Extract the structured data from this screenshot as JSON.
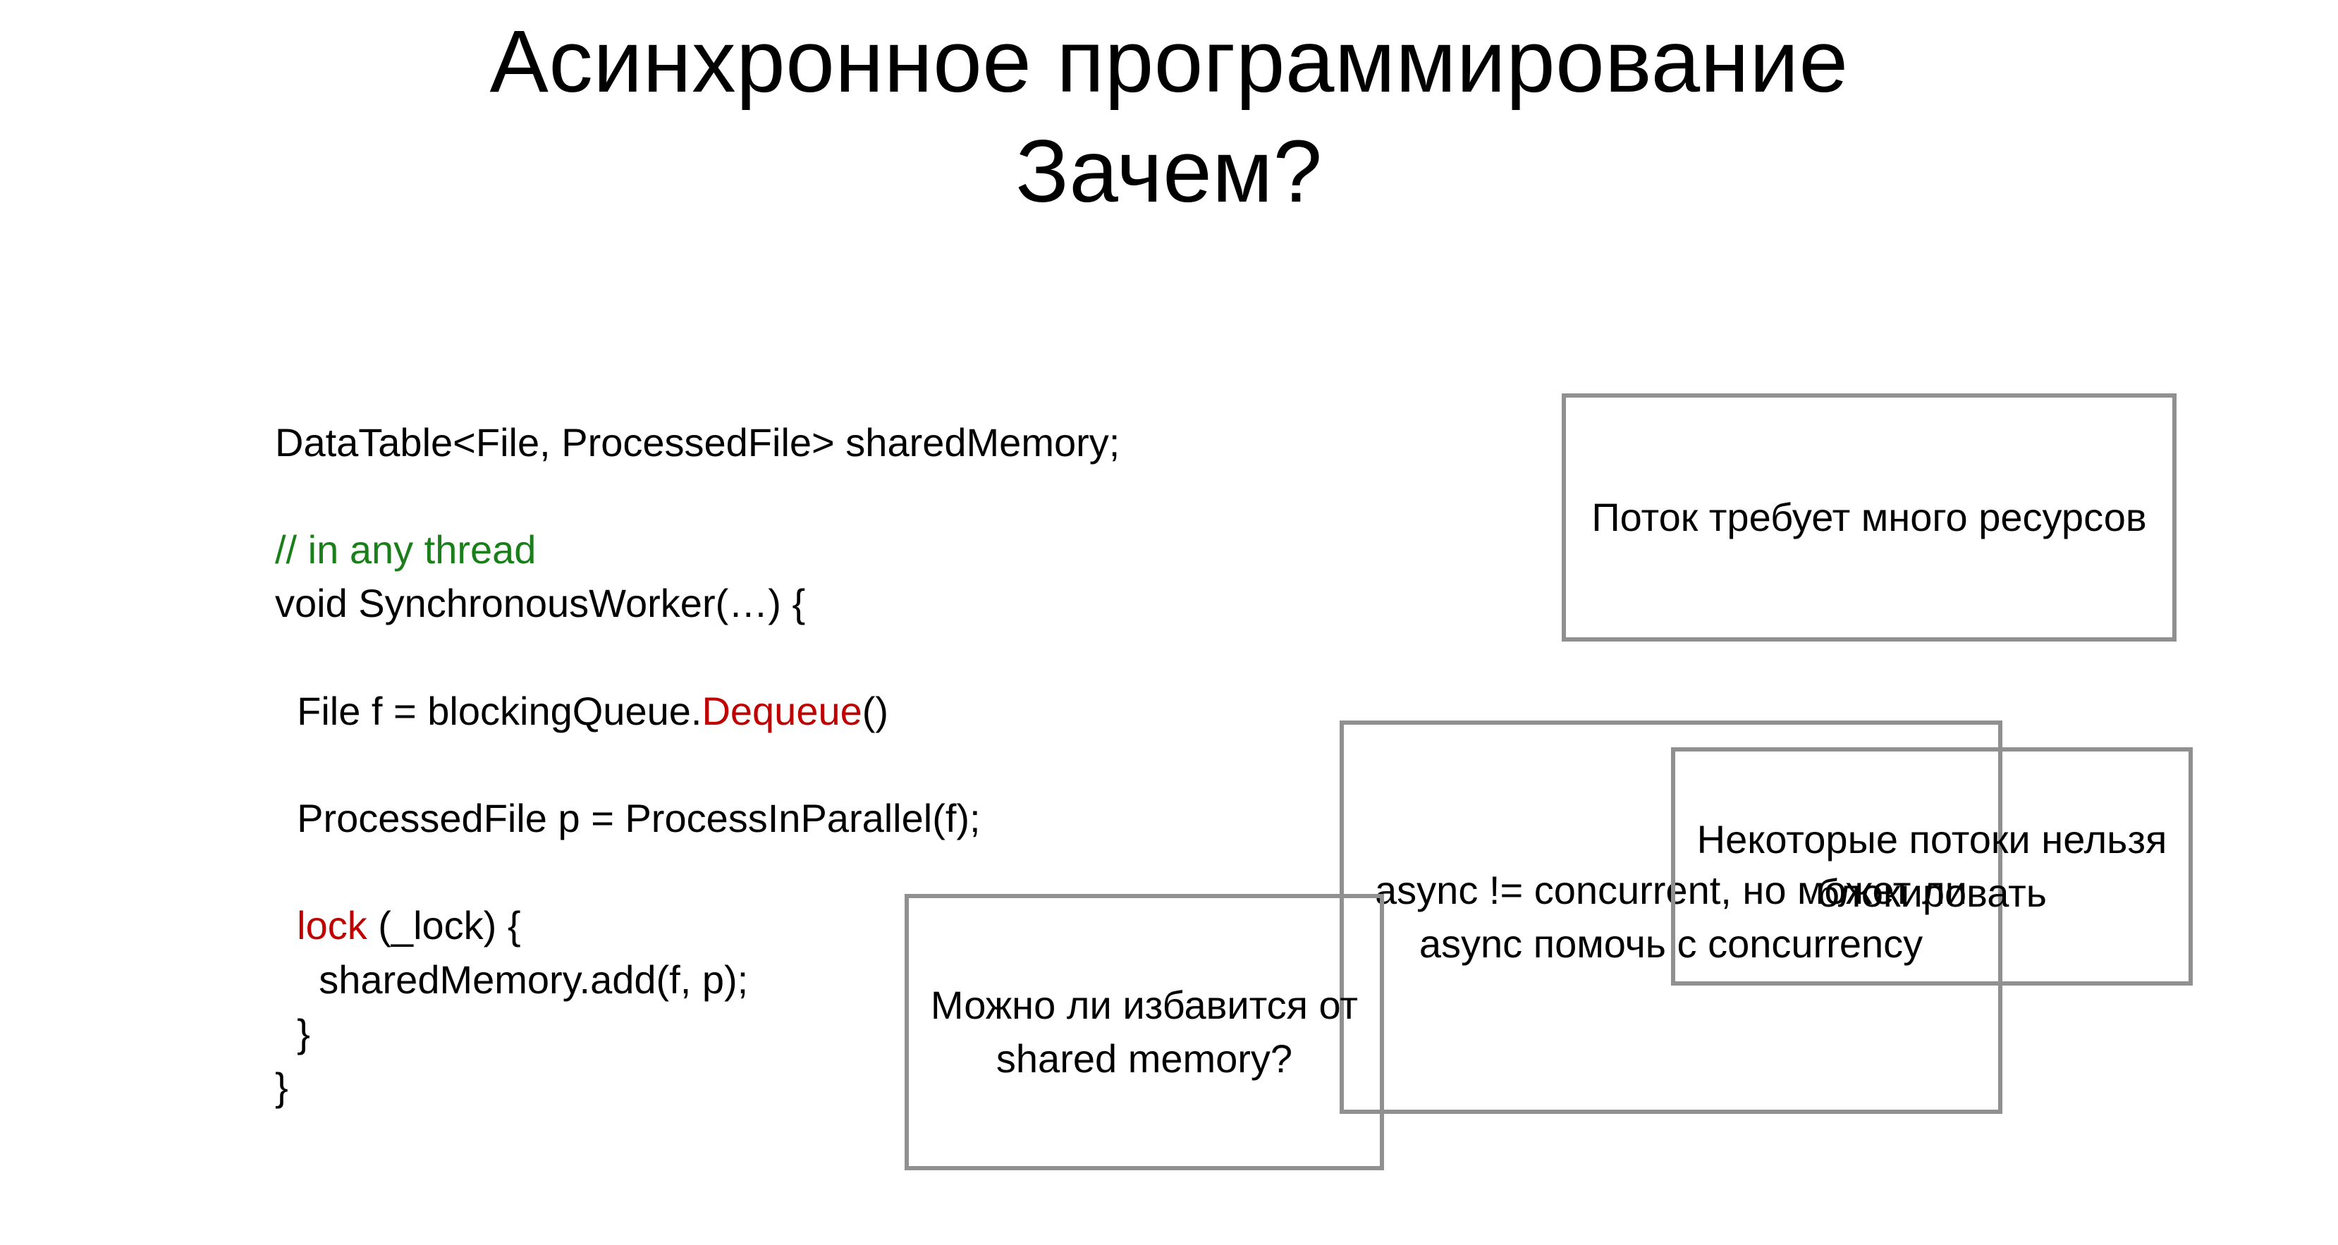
{
  "title": {
    "line1": "Асинхронное программирование",
    "line2": "Зачем?"
  },
  "code": {
    "l1": "DataTable<File, ProcessedFile> sharedMemory;",
    "l2_comment": "// in any thread",
    "l3": "void SynchronousWorker(…) {",
    "l4_a": "  File f = blockingQueue.",
    "l4_b": "Dequeue",
    "l4_c": "()",
    "l5": "  ProcessedFile p = ProcessInParallel(f);",
    "l6_a": "  ",
    "l6_b": "lock",
    "l6_c": " (_lock) {",
    "l7": "    sharedMemory.add(f, p);",
    "l8": "  }",
    "l9": "}"
  },
  "boxes": {
    "a": "Поток требует много ресурсов",
    "b": "async != concurrent, но\nможет ли async помочь с concurrency",
    "c": "Некоторые потоки нельзя блокировать",
    "d": "Можно ли избавится от shared memory?"
  }
}
